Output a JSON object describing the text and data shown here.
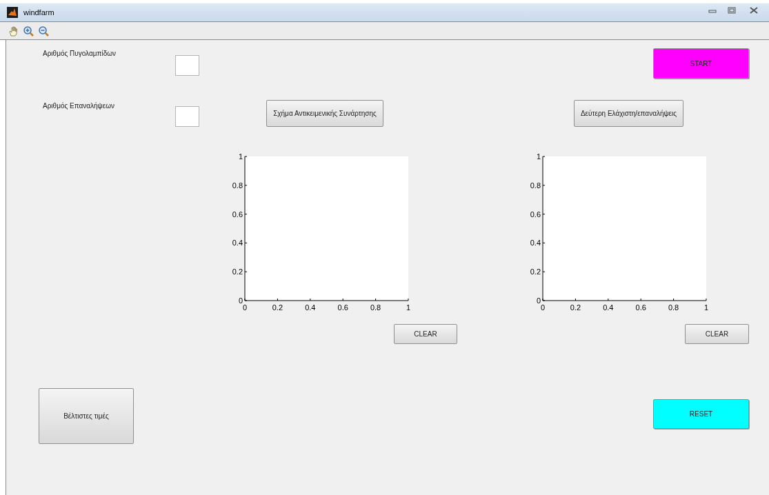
{
  "window": {
    "title": "windfarm"
  },
  "toolbar": {
    "tools": [
      {
        "kind": "pan"
      },
      {
        "kind": "zoom_in"
      },
      {
        "kind": "zoom_out"
      }
    ]
  },
  "labels": [
    {
      "text": "Αριθμός Πυγολαμπίδων"
    },
    {
      "text": "Αριθμός Επαναλήψεων"
    }
  ],
  "buttons": [
    {
      "kind": "start",
      "label": "START",
      "color": "#ff00ff"
    },
    {
      "kind": "objective_plot",
      "label": "Σχήμα Αντικειμενικής Συνάρτησης"
    },
    {
      "kind": "second_min",
      "label": "Δεύτερη Ελάχιστη/επαναλήψεις"
    },
    {
      "kind": "clear_left",
      "label": "CLEAR"
    },
    {
      "kind": "clear_right",
      "label": "CLEAR"
    },
    {
      "kind": "best",
      "label": "Βέλτιστες τιμές"
    },
    {
      "kind": "reset",
      "label": "RESET",
      "color": "#00ffff"
    }
  ],
  "axes": [
    {
      "chart_data": {
        "type": "line",
        "xlim": [
          0,
          1
        ],
        "ylim": [
          0,
          1
        ],
        "xticks": [
          0,
          0.2,
          0.4,
          0.6,
          0.8,
          1
        ],
        "yticks": [
          0,
          0.2,
          0.4,
          0.6,
          0.8,
          1
        ]
      }
    },
    {
      "chart_data": {
        "type": "line",
        "xlim": [
          0,
          1
        ],
        "ylim": [
          0,
          1
        ],
        "xticks": [
          0,
          0.2,
          0.4,
          0.6,
          0.8,
          1
        ],
        "yticks": [
          0,
          0.2,
          0.4,
          0.6,
          0.8,
          1
        ]
      }
    }
  ]
}
